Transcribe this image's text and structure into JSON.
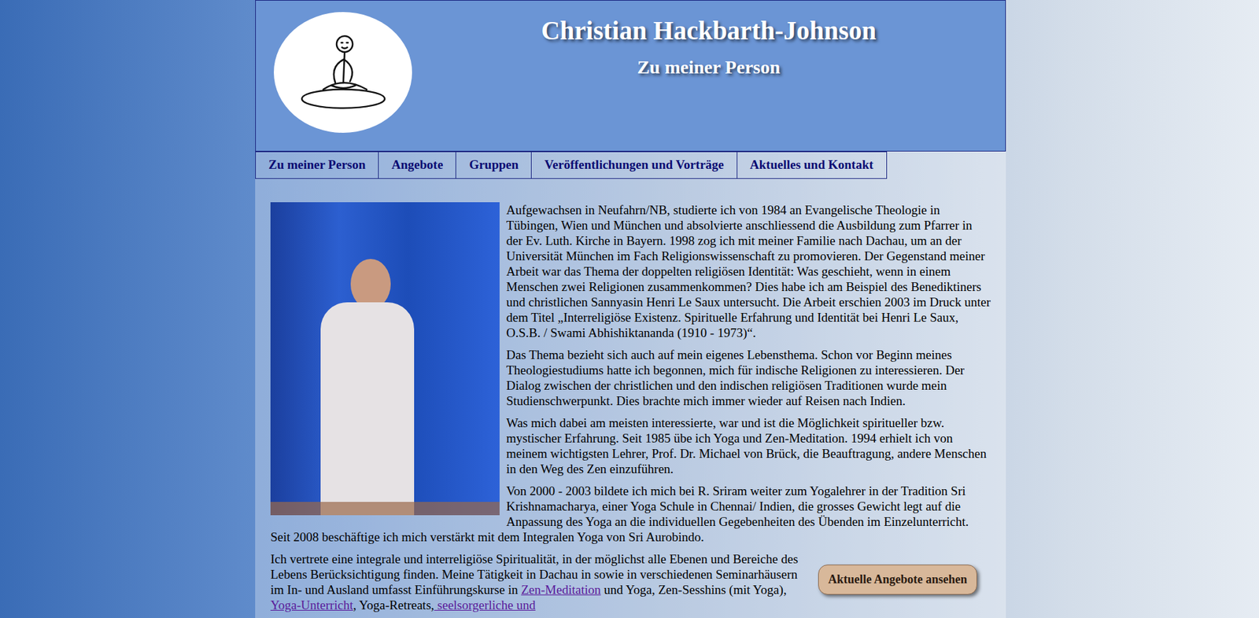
{
  "header": {
    "title": "Christian Hackbarth-Johnson",
    "subtitle": "Zu meiner Person"
  },
  "nav": [
    {
      "label": "Zu meiner Person"
    },
    {
      "label": "Angebote"
    },
    {
      "label": "Gruppen"
    },
    {
      "label": "Veröffentlichungen und Vorträge"
    },
    {
      "label": "Aktuelles und Kontakt"
    }
  ],
  "paragraphs": [
    [
      {
        "kind": "text",
        "text": "Aufgewachsen in Neufahrn/NB, studierte ich von 1984 an Evangelische Theologie in Tübingen, Wien und München und absolvierte anschliessend die Ausbildung zum Pfarrer in der Ev. Luth. Kirche in Bayern. 1998 zog ich mit meiner Familie nach Dachau, um an der Universität München im Fach Religionswissenschaft zu promovieren. Der Gegenstand meiner Arbeit war das Thema der doppelten religiösen Identität: Was geschieht, wenn in einem Menschen zwei Religionen zusammenkommen? Dies habe ich am Beispiel des Benediktiners und christlichen Sannyasin Henri Le Saux untersucht. Die Arbeit erschien 2003 im Druck unter dem Titel „Interreligiöse Existenz. Spirituelle Erfahrung und Identität bei Henri Le Saux, O.S.B. / Swami Abhishiktananda (1910 - 1973)“."
      }
    ],
    [
      {
        "kind": "text",
        "text": "Das Thema bezieht sich auch auf mein eigenes Lebensthema. Schon vor Beginn meines Theologiestudiums hatte ich begonnen, mich für indische Religionen zu interessieren. Der Dialog zwischen der christlichen und den indischen religiösen Traditionen wurde mein Studienschwerpunkt. Dies brachte mich immer wieder auf Reisen nach Indien."
      }
    ],
    [
      {
        "kind": "text",
        "text": "Was mich dabei am meisten interessierte, war und ist die Möglichkeit spiritueller bzw. mystischer Erfahrung. Seit 1985 übe ich Yoga und Zen-Meditation. 1994 erhielt ich von meinem wichtigsten Lehrer, Prof. Dr. Michael von Brück, die Beauftragung, andere Menschen in den Weg des Zen einzuführen."
      }
    ],
    [
      {
        "kind": "text",
        "text": "Von 2000 - 2003 bildete ich mich bei R. Sriram weiter zum Yogalehrer in der Tradition Sri Krishnamacharya, einer Yoga Schule in Chennai/ Indien, die grosses Gewicht legt auf die Anpassung des Yoga an die individuellen Gegebenheiten des Übenden im Einzelunterricht. Seit 2008 beschäftige ich mich verstärkt mit dem Integralen Yoga von Sri Aurobindo."
      }
    ],
    [
      {
        "kind": "text",
        "text": "Ich vertrete eine integrale und interreligiöse Spiritualität, in der möglichst alle Ebenen und Bereiche des Lebens Berücksichtigung finden. Meine Tätigkeit in Dachau in sowie in verschiedenen Seminarhäusern im In- und Ausland umfasst Einführungskurse in "
      },
      {
        "kind": "link",
        "text": "Zen-Meditation"
      },
      {
        "kind": "text",
        "text": " und Yoga, Zen-Sesshins (mit Yoga), "
      },
      {
        "kind": "link",
        "text": "Yoga-Unterricht"
      },
      {
        "kind": "text",
        "text": ", Yoga-Retreats,"
      },
      {
        "kind": "link",
        "text": " seelsorgerliche und"
      }
    ]
  ],
  "cta": {
    "label": "Aktuelle Angebote ansehen"
  }
}
